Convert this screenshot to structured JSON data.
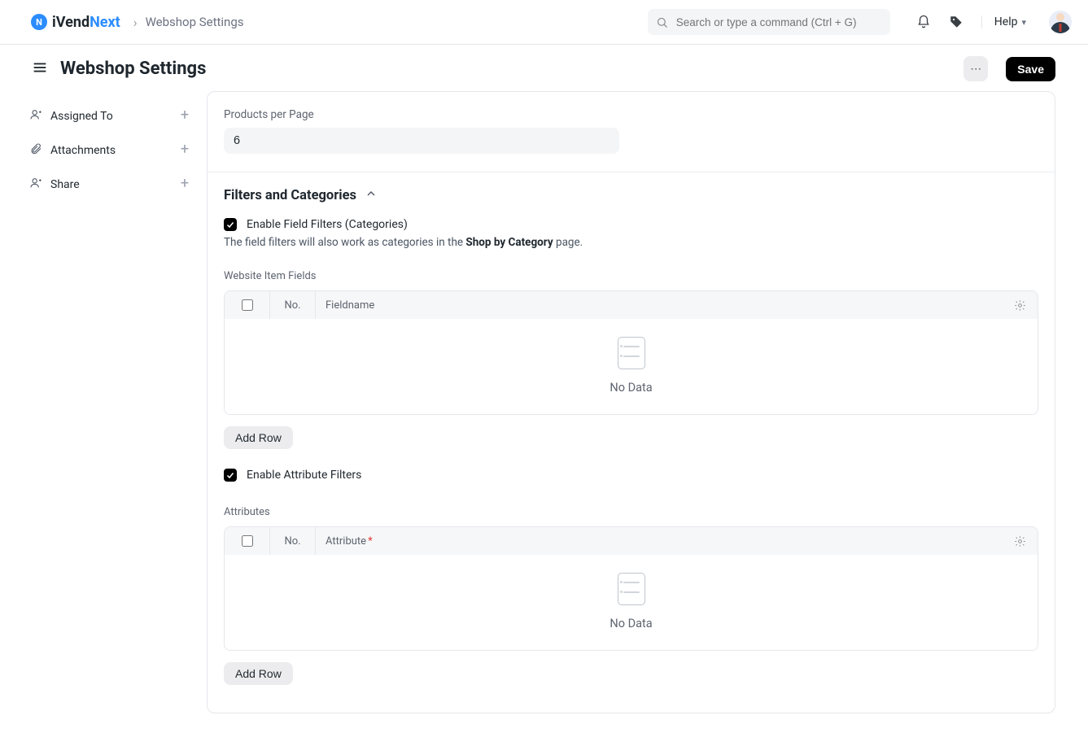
{
  "brand": {
    "part1": "iVend",
    "part2": "Next",
    "mark": "N"
  },
  "breadcrumb": {
    "item": "Webshop Settings"
  },
  "search": {
    "placeholder": "Search or type a command (Ctrl + G)"
  },
  "help": {
    "label": "Help"
  },
  "page": {
    "title": "Webshop Settings",
    "more": "⋯",
    "save": "Save"
  },
  "sidebar": {
    "items": [
      {
        "label": "Assigned To"
      },
      {
        "label": "Attachments"
      },
      {
        "label": "Share"
      }
    ]
  },
  "products_per_page": {
    "label": "Products per Page",
    "value": "6"
  },
  "filters_section": {
    "title": "Filters and Categories",
    "enable_field_filters": {
      "label": "Enable Field Filters (Categories)",
      "checked": true
    },
    "help_text_pre": "The field filters will also work as categories in the ",
    "help_text_bold": "Shop by Category",
    "help_text_post": " page.",
    "website_item_fields": {
      "label": "Website Item Fields",
      "columns": {
        "no": "No.",
        "fieldname": "Fieldname"
      },
      "empty": "No Data",
      "add_row": "Add Row"
    },
    "enable_attribute_filters": {
      "label": "Enable Attribute Filters",
      "checked": true
    },
    "attributes": {
      "label": "Attributes",
      "columns": {
        "no": "No.",
        "attribute": "Attribute"
      },
      "required_marker": "*",
      "empty": "No Data",
      "add_row": "Add Row"
    }
  }
}
